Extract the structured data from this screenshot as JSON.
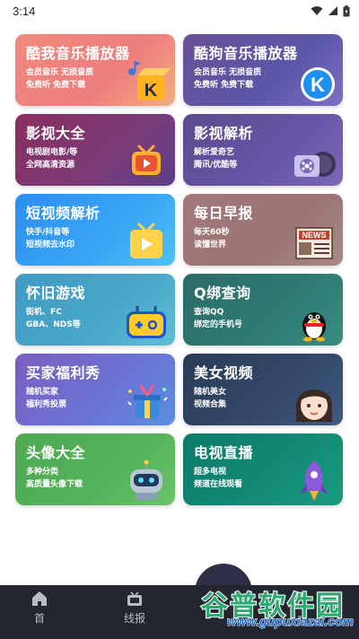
{
  "status_bar": {
    "time": "3:14"
  },
  "cards": [
    {
      "title": "酷我音乐播放器",
      "lines": [
        "会员音乐 无损音质",
        "免费听 免费下载"
      ],
      "icon": "kuwo-music-icon"
    },
    {
      "title": "酷狗音乐播放器",
      "lines": [
        "会员音乐 无损音质",
        "免费听 免费下载"
      ],
      "icon": "kugou-music-icon"
    },
    {
      "title": "影视大全",
      "lines": [
        "电视剧电影/等",
        "全网高清资源"
      ],
      "icon": "tv-play-icon"
    },
    {
      "title": "影视解析",
      "lines": [
        "解析爱奇艺",
        "腾讯/优酷等"
      ],
      "icon": "video-reel-icon"
    },
    {
      "title": "短视频解析",
      "lines": [
        "快手/抖音等",
        "短视频去水印"
      ],
      "icon": "video-play-icon"
    },
    {
      "title": "每日早报",
      "lines": [
        "每天60秒",
        "读懂世界"
      ],
      "icon": "newspaper-icon"
    },
    {
      "title": "怀旧游戏",
      "lines": [
        "街机、FC",
        "GBA、NDS等"
      ],
      "icon": "gamepad-icon"
    },
    {
      "title": "Q绑查询",
      "lines": [
        "查询QQ",
        "绑定的手机号"
      ],
      "icon": "qq-penguin-icon"
    },
    {
      "title": "买家福利秀",
      "lines": [
        "随机买家",
        "福利秀投票"
      ],
      "icon": "gift-box-icon"
    },
    {
      "title": "美女视频",
      "lines": [
        "随机美女",
        "视频合集"
      ],
      "icon": "girl-avatar-icon"
    },
    {
      "title": "头像大全",
      "lines": [
        "多种分类",
        "高质量头像下载"
      ],
      "icon": "robot-icon"
    },
    {
      "title": "电视直播",
      "lines": [
        "超多电视",
        "频道在线观看"
      ],
      "icon": "rocket-icon"
    }
  ],
  "bottom_nav": {
    "items": [
      {
        "label": "首",
        "icon": "home-icon"
      },
      {
        "label": "线报",
        "icon": "report-icon"
      }
    ]
  },
  "watermark": {
    "title": "谷普软件园",
    "url": "www.gupuxiazai.com"
  },
  "colors": {
    "nav_bg": "#23252f",
    "fab": "#2d2f46",
    "watermark_green": "#2da870",
    "watermark_blue": "#1e6fd0"
  }
}
